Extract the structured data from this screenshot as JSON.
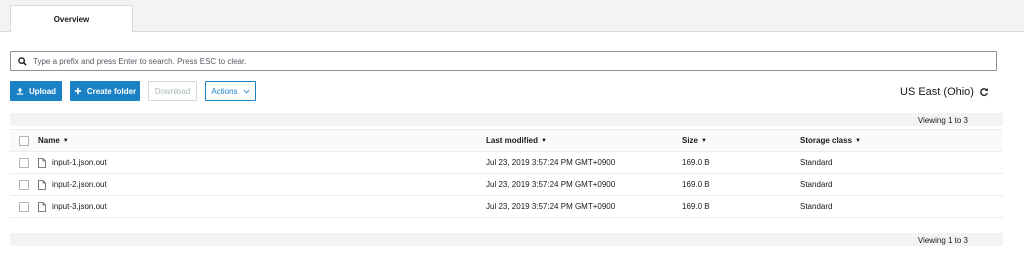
{
  "tabs": [
    {
      "label": "Overview"
    }
  ],
  "search": {
    "placeholder": "Type a prefix and press Enter to search. Press ESC to clear.",
    "value": ""
  },
  "toolbar": {
    "upload_label": "Upload",
    "create_folder_label": "Create folder",
    "download_label": "Download",
    "actions_label": "Actions"
  },
  "region": "US East (Ohio)",
  "viewing": {
    "top": "Viewing 1 to 3",
    "bottom": "Viewing 1 to 3"
  },
  "table": {
    "headers": {
      "name": "Name",
      "modified": "Last modified",
      "size": "Size",
      "class": "Storage class"
    },
    "rows": [
      {
        "name": "input-1.json.out",
        "modified": "Jul 23, 2019 3:57:24 PM GMT+0900",
        "size": "169.0 B",
        "class": "Standard"
      },
      {
        "name": "input-2.json.out",
        "modified": "Jul 23, 2019 3:57:24 PM GMT+0900",
        "size": "169.0 B",
        "class": "Standard"
      },
      {
        "name": "input-3.json.out",
        "modified": "Jul 23, 2019 3:57:24 PM GMT+0900",
        "size": "169.0 B",
        "class": "Standard"
      }
    ]
  },
  "colors": {
    "accent": "#1b81c5",
    "border": "#d5dbdb",
    "band": "#f2f3f3"
  },
  "icons": {
    "search": "search-icon",
    "upload": "upload-icon",
    "plus": "plus-icon",
    "chevron": "chevron-down-icon",
    "refresh": "refresh-icon",
    "file": "file-icon",
    "sort": "sort-caret-icon"
  }
}
